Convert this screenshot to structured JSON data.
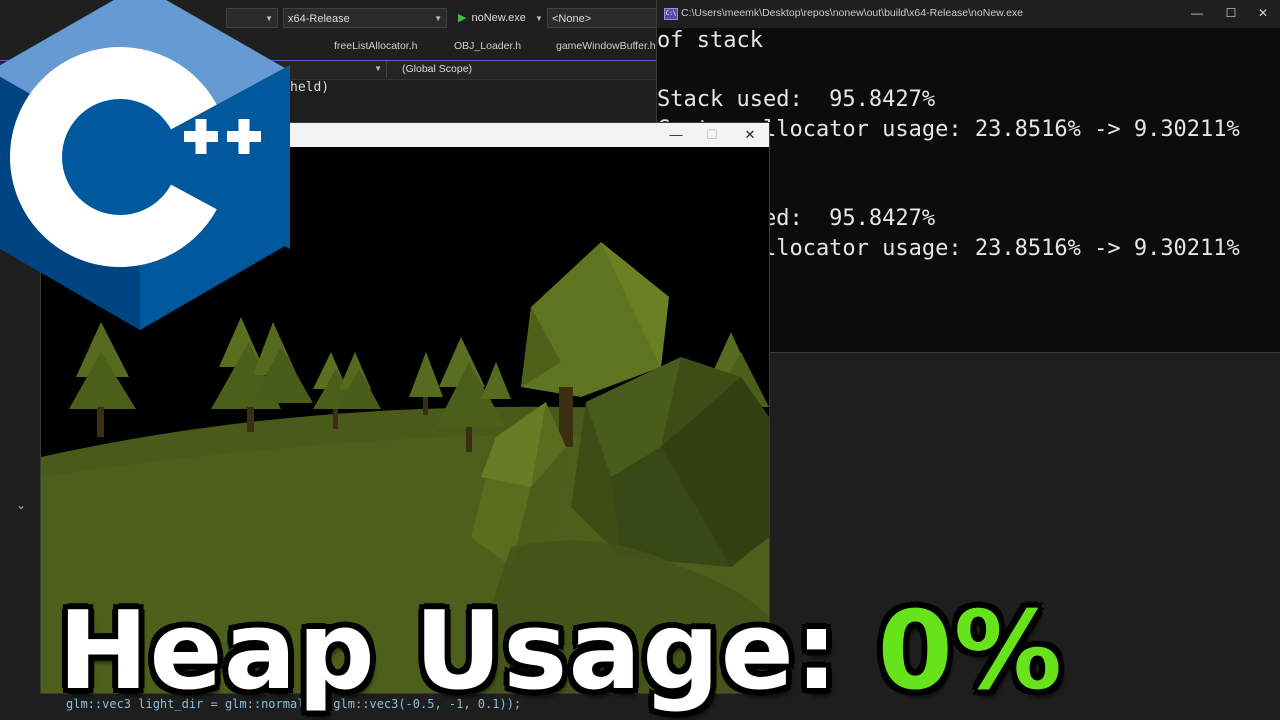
{
  "ide": {
    "config_combo": "x64-Release",
    "run_target": "noNew.exe",
    "debug_target": "<None>",
    "tabs": [
      "freeListAllocator.h",
      "OBJ_Loader.h",
      "gameWindowBuffer.h"
    ],
    "scope_combo": "(Global Scope)",
    "code_fragment_top": "held)",
    "code_fragment_bottom": "glm::vec3 light_dir = glm::normalize(glm::vec3(-0.5, -1, 0.1));"
  },
  "console": {
    "title": "C:\\Users\\meemk\\Desktop\\repos\\nonew\\out\\build\\x64-Release\\noNew.exe",
    "icon_label": "C:\\",
    "lines": [
      "of stack",
      "",
      "Stack used:  95.8427%",
      "Custom allocator usage: 23.8516% -> 9.30211%",
      "",
      "",
      "Stack used:  95.8427%",
      "Custom allocator usage: 23.8516% -> 9.30211%"
    ]
  },
  "game_window": {
    "buttons": {
      "minimize": "—",
      "maximize": "☐",
      "close": "✕"
    }
  },
  "logo": {
    "text": "C++",
    "plus": "++",
    "icon": "cpp-logo-icon"
  },
  "headline": {
    "label": "Heap Usage:",
    "value": "0%"
  },
  "colors": {
    "accent_green": "#66e31a",
    "cpp_blue_light": "#659ad2",
    "cpp_blue_dark": "#004482",
    "cpp_blue_mid": "#00599c",
    "grass": "#4a5a1a"
  }
}
